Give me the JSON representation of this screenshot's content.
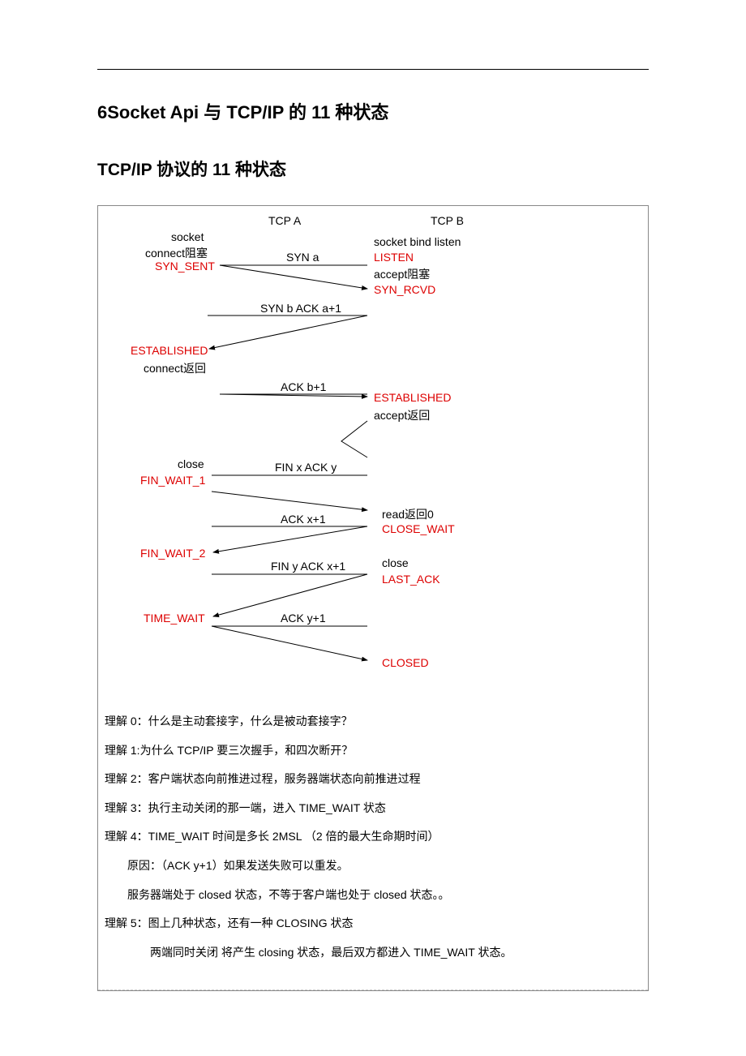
{
  "title_main": "6Socket Api 与 TCP/IP 的 11 种状态",
  "title_sub": "TCP/IP 协议的 11 种状态",
  "diagram": {
    "headerA": "TCP A",
    "headerB": "TCP B",
    "leftLabels": {
      "socket": "socket",
      "connect_block": "connect阻塞",
      "syn_sent": "SYN_SENT",
      "established": "ESTABLISHED",
      "connect_return": "connect返回",
      "close": "close",
      "fin_wait_1": "FIN_WAIT_1",
      "fin_wait_2": "FIN_WAIT_2",
      "time_wait": "TIME_WAIT"
    },
    "rightLabels": {
      "socket_bind_listen": "socket bind listen",
      "listen": "LISTEN",
      "accept_block": "accept阻塞",
      "syn_rcvd": "SYN_RCVD",
      "established": "ESTABLISHED",
      "accept_return": "accept返回",
      "read_return_0": "read返回0",
      "close_wait": "CLOSE_WAIT",
      "close": "close",
      "last_ack": "LAST_ACK",
      "closed": "CLOSED"
    },
    "arrowLabels": {
      "syn_a": "SYN a",
      "syn_b_ack": "SYN b  ACK a+1",
      "ack_b1": "ACK b+1",
      "fin_x_ack_y": "FIN x ACK y",
      "ack_x1": "ACK x+1",
      "fin_y_ack_x1": "FIN y ACK x+1",
      "ack_y1": "ACK y+1"
    }
  },
  "notes": {
    "n0": "理解 0：什么是主动套接字，什么是被动套接字？",
    "n1": "理解 1:为什么 TCP/IP 要三次握手，和四次断开？",
    "n2": "理解 2：客户端状态向前推进过程，服务器端状态向前推进过程",
    "n3": "理解 3：执行主动关闭的那一端，进入 TIME_WAIT 状态",
    "n4": "理解 4：TIME_WAIT  时间是多长 2MSL  （2 倍的最大生命期时间）",
    "n4a": "原因：（ACK y+1）如果发送失败可以重发。",
    "n4b": "服务器端处于 closed 状态，不等于客户端也处于 closed 状态。。",
    "n5": "理解 5：图上几种状态，还有一种 CLOSING 状态",
    "n5a": "两端同时关闭     将产生 closing 状态，最后双方都进入 TIME_WAIT 状态。"
  }
}
